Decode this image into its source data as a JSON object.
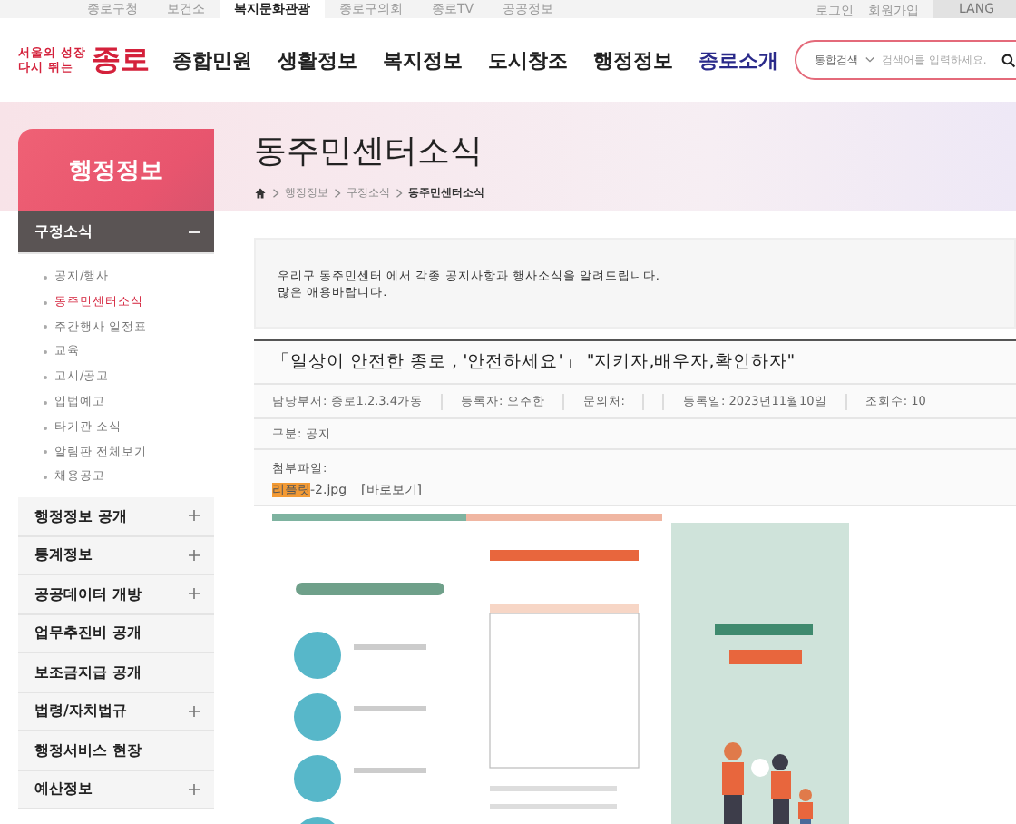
{
  "top_bar": {
    "links": [
      {
        "label": "종로구청",
        "selected": false
      },
      {
        "label": "보건소",
        "selected": false
      },
      {
        "label": "복지문화관광",
        "selected": true
      },
      {
        "label": "종로구의회",
        "selected": false
      },
      {
        "label": "종로TV",
        "selected": false
      },
      {
        "label": "공공정보",
        "selected": false
      }
    ],
    "account": [
      "로그인",
      "회원가입"
    ],
    "language": "LANG"
  },
  "header": {
    "logo_small": "서울의 성장",
    "logo_small2": "다시 뛰는",
    "logo_big": "종로",
    "nav": [
      {
        "label": "종합민원",
        "selected": false
      },
      {
        "label": "생활정보",
        "selected": false
      },
      {
        "label": "복지정보",
        "selected": false
      },
      {
        "label": "도시창조",
        "selected": false
      },
      {
        "label": "행정정보",
        "selected": false
      },
      {
        "label": "종로소개",
        "selected": true
      }
    ],
    "search": {
      "scope": "통합검색",
      "placeholder": "검색어를 입력하세요."
    }
  },
  "sidebar": {
    "title": "행정정보",
    "items": [
      {
        "label": "구정소식",
        "expanded": true,
        "expandable": true,
        "children": [
          {
            "label": "공지/행사",
            "selected": false
          },
          {
            "label": "동주민센터소식",
            "selected": true
          },
          {
            "label": "주간행사 일정표",
            "selected": false
          },
          {
            "label": "교육",
            "selected": false
          },
          {
            "label": "고시/공고",
            "selected": false
          },
          {
            "label": "입법예고",
            "selected": false
          },
          {
            "label": "타기관 소식",
            "selected": false
          },
          {
            "label": "알림판 전체보기",
            "selected": false
          },
          {
            "label": "채용공고",
            "selected": false
          }
        ]
      },
      {
        "label": "행정정보 공개",
        "expanded": false,
        "expandable": true
      },
      {
        "label": "통계정보",
        "expanded": false,
        "expandable": true
      },
      {
        "label": "공공데이터 개방",
        "expanded": false,
        "expandable": true
      },
      {
        "label": "업무추진비 공개",
        "expanded": false,
        "expandable": false
      },
      {
        "label": "보조금지급 공개",
        "expanded": false,
        "expandable": false
      },
      {
        "label": "법령/자치법규",
        "expanded": false,
        "expandable": true
      },
      {
        "label": "행정서비스 현장",
        "expanded": false,
        "expandable": false
      },
      {
        "label": "예산정보",
        "expanded": false,
        "expandable": true
      }
    ]
  },
  "page": {
    "title": "동주민센터소식",
    "breadcrumb": [
      "행정정보",
      "구정소식",
      "동주민센터소식"
    ],
    "intro": [
      "우리구 동주민센터 에서 각종 공지사항과 행사소식을 알려드립니다.",
      "많은 애용바랍니다."
    ],
    "post": {
      "title": "「일상이 안전한 종로 , '안전하세요'」 \"지키자,배우자,확인하자\"",
      "meta_left": [
        {
          "label": "담당부서:",
          "value": "종로1.2.3.4가동"
        },
        {
          "label": "등록자:",
          "value": "오주한"
        },
        {
          "label": "문의처:"
        }
      ],
      "meta_right": [
        {
          "label": "등록일:",
          "value": "2023년11월10일"
        },
        {
          "label": "조회수:",
          "value": "10"
        }
      ],
      "category": {
        "label": "구분:",
        "value": "공지"
      },
      "attachment": {
        "label": "첨부파일:",
        "file_highlight": "리플릿",
        "file_rest": "-2.jpg",
        "view": "[바로보기]"
      }
    }
  }
}
